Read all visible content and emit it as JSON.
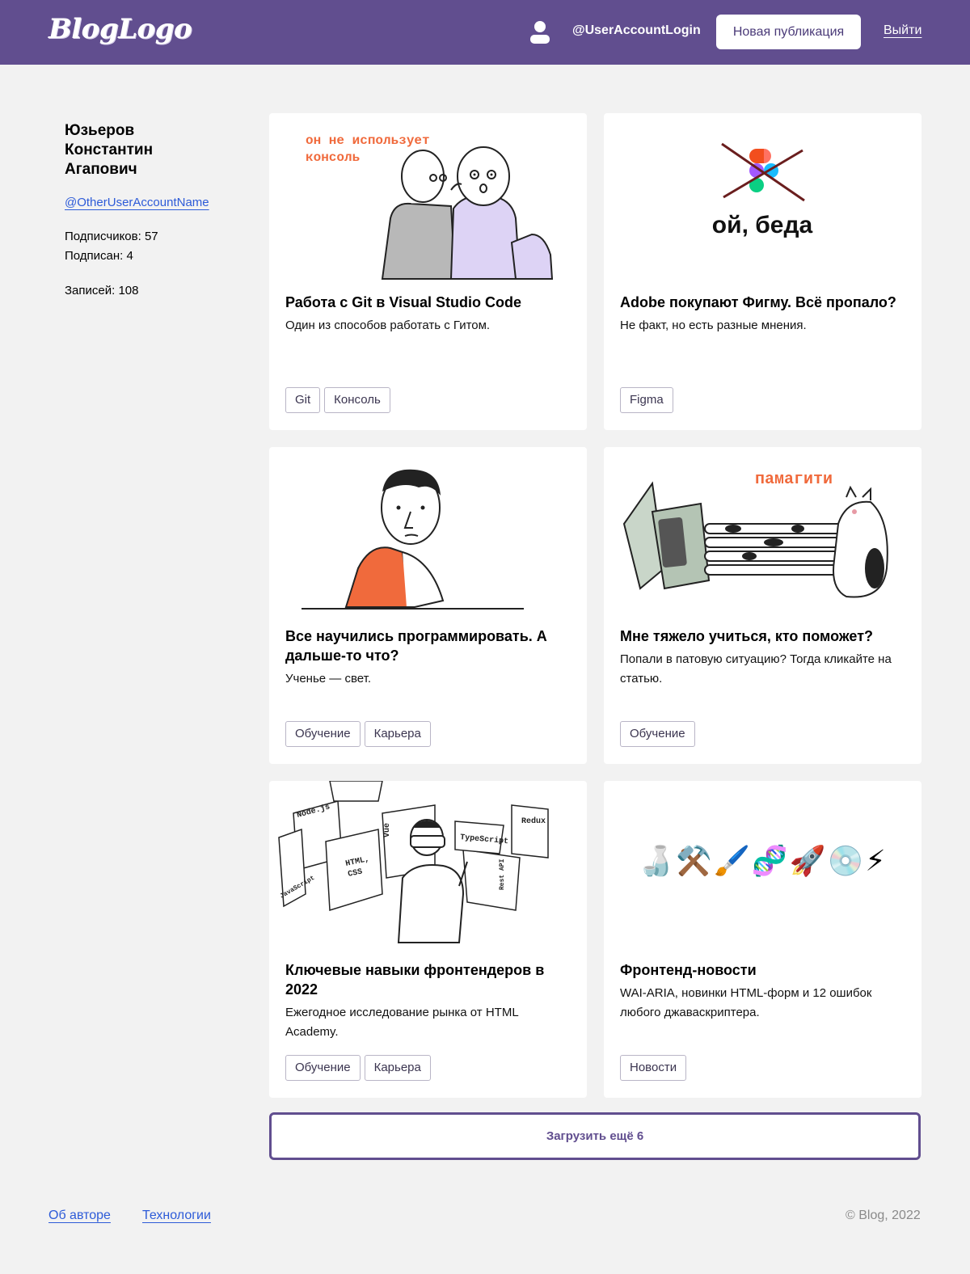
{
  "header": {
    "logo": "BlogLogo",
    "user_login": "@UserAccountLogin",
    "new_post_label": "Новая публикация",
    "exit_label": "Выйти",
    "bg_color": "#614e8f"
  },
  "profile": {
    "name": "Юзьеров Константин Агапович",
    "handle": "@OtherUserAccountName",
    "followers": "Подписчиков: 57",
    "following": "Подписан: 4",
    "posts": "Записей: 108"
  },
  "cards": [
    {
      "title": "Работа с Git в Visual Studio Code",
      "description": "Один из способов работать с Гитом.",
      "image_caption": "он не использует\nконсоль",
      "tags": [
        "Git",
        "Консоль"
      ]
    },
    {
      "title": "Adobe покупают Фигму. Всё пропало?",
      "description": "Не факт, но есть разные мнения.",
      "image_caption": "ой, беда",
      "tags": [
        "Figma"
      ]
    },
    {
      "title": "Все научились программировать. А дальше-то что?",
      "description": "Ученье — свет.",
      "tags": [
        "Обучение",
        "Карьера"
      ]
    },
    {
      "title": "Мне тяжело учиться, кто поможет?",
      "description": "Попали в патовую ситуацию? Тогда кликайте на статью.",
      "image_caption": "памагити",
      "tags": [
        "Обучение"
      ]
    },
    {
      "title": "Ключевые навыки фронтендеров в 2022",
      "description": "Ежегодное исследование рынка от HTML Academy.",
      "image_labels": [
        "Node.js",
        "Vue",
        "Redux",
        "TypeScript",
        "HTML, CSS",
        "JavaScript",
        "Rest API"
      ],
      "tags": [
        "Обучение",
        "Карьера"
      ]
    },
    {
      "title": "Фронтенд-новости",
      "description": "WAI-ARIA, новинки HTML-форм и 12 ошибок любого джаваскриптера.",
      "image_emoji": "🍶⚒️🖌️🧬🚀💿⚡",
      "tags": [
        "Новости"
      ]
    }
  ],
  "load_more_label": "Загрузить ещё 6",
  "footer": {
    "about_label": "Об авторе",
    "tech_label": "Технологии",
    "copyright": "© Blog, 2022"
  }
}
